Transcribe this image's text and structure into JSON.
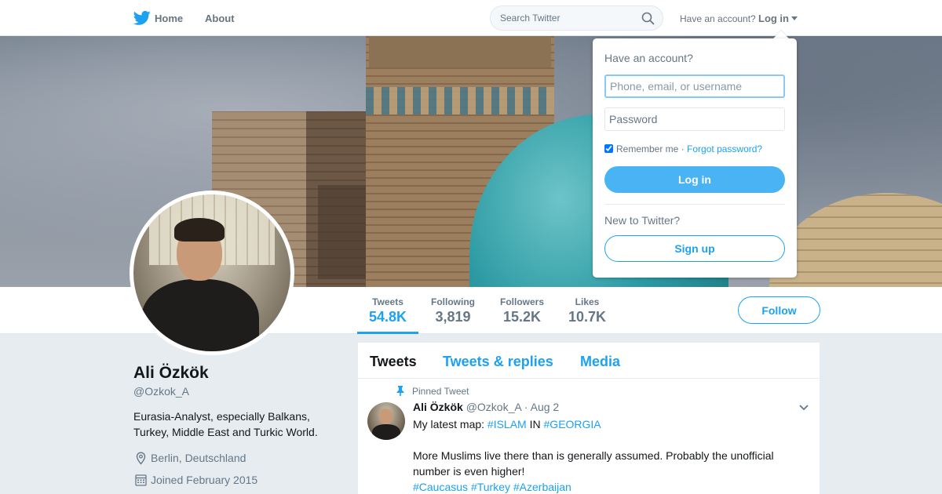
{
  "nav": {
    "home_label": "Home",
    "about_label": "About",
    "search_placeholder": "Search Twitter",
    "have_account": "Have an account?",
    "login_label": "Log in"
  },
  "profile": {
    "name": "Ali Özkök",
    "handle": "@Ozkok_A",
    "bio": "Eurasia-Analyst, especially Balkans, Turkey, Middle East and Turkic World.",
    "location": "Berlin, Deutschland",
    "joined": "Joined February 2015",
    "follow_label": "Follow"
  },
  "stats": [
    {
      "label": "Tweets",
      "value": "54.8K",
      "active": true
    },
    {
      "label": "Following",
      "value": "3,819"
    },
    {
      "label": "Followers",
      "value": "15.2K"
    },
    {
      "label": "Likes",
      "value": "10.7K"
    }
  ],
  "tabs": [
    "Tweets",
    "Tweets & replies",
    "Media"
  ],
  "tweet": {
    "pinned_label": "Pinned Tweet",
    "name": "Ali Özkök",
    "handle": "@Ozkok_A",
    "dot": "·",
    "date": "Aug 2",
    "line1_prefix": "My latest map:",
    "line1_tag1": "#ISLAM",
    "line1_mid": "IN",
    "line1_tag2": "#GEORGIA",
    "line2": "More Muslims live there than is generally assumed. Probably the unofficial number is even higher!",
    "hashtags": [
      "#Caucasus",
      "#Turkey",
      "#Azerbaijan"
    ]
  },
  "login_dropdown": {
    "title": "Have an account?",
    "username_placeholder": "Phone, email, or username",
    "password_placeholder": "Password",
    "remember_label": "Remember me",
    "separator": "·",
    "forgot_label": "Forgot password?",
    "login_button": "Log in",
    "new_label": "New to Twitter?",
    "signup_button": "Sign up"
  },
  "colors": {
    "accent": "#1da1f2",
    "background": "#e6ecf0"
  }
}
